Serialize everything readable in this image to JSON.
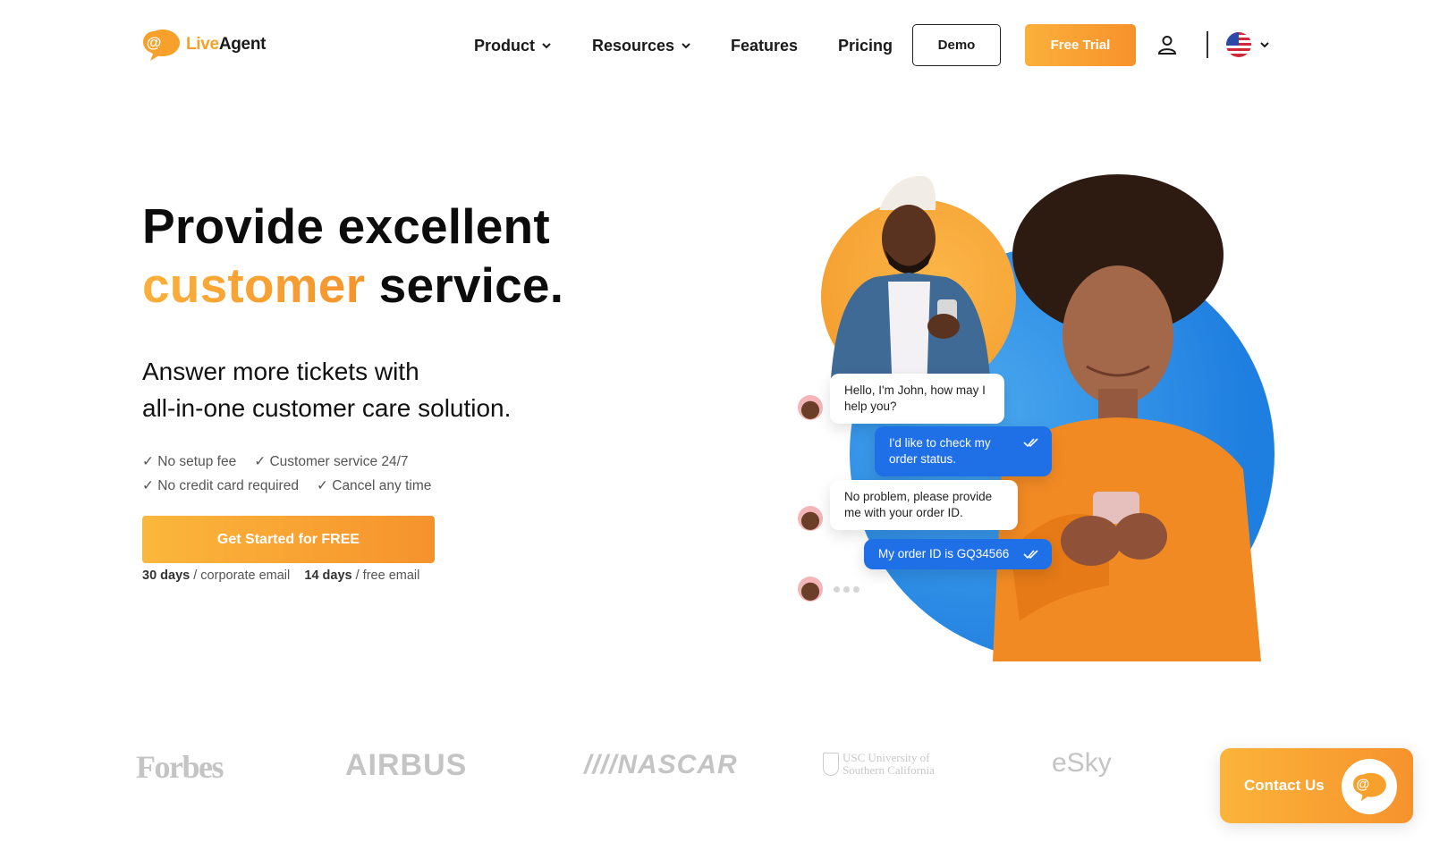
{
  "header": {
    "logo": {
      "live": "Live",
      "agent": "Agent"
    },
    "nav": [
      {
        "label": "Product",
        "has_dropdown": true
      },
      {
        "label": "Resources",
        "has_dropdown": true
      },
      {
        "label": "Features",
        "has_dropdown": false
      },
      {
        "label": "Pricing",
        "has_dropdown": false
      }
    ],
    "demo_label": "Demo",
    "free_trial_label": "Free Trial",
    "user_icon": "user-icon",
    "language_icon": "us-flag-icon"
  },
  "hero": {
    "title_line1": "Provide excellent",
    "title_accent": "customer",
    "title_rest": " service.",
    "subtitle_line1": "Answer more tickets with",
    "subtitle_line2": "all-in-one customer care solution.",
    "checks": [
      [
        "✓ No setup fee",
        "✓ Customer service 24/7"
      ],
      [
        "✓ No credit card required",
        "✓ Cancel any time"
      ]
    ],
    "cta_label": "Get Started for FREE",
    "trial_note": {
      "corporate_days": "30 days",
      "corporate_text": " / corporate email",
      "free_days": "14 days",
      "free_text": " / free email"
    }
  },
  "chat": {
    "messages": [
      {
        "from": "agent",
        "text": "Hello, I'm John, how may I help you?"
      },
      {
        "from": "customer",
        "text": "I'd like to check my order status.",
        "status": "read"
      },
      {
        "from": "agent",
        "text": "No problem, please provide me with your order ID."
      },
      {
        "from": "customer",
        "text": "My order ID is GQ34566",
        "status": "read"
      }
    ],
    "typing": true
  },
  "logos": {
    "forbes": "Forbes",
    "airbus": "AIRBUS",
    "nascar": "////NASCAR",
    "usc_line1": "USC University of",
    "usc_line2": "Southern California",
    "esky": "eSky"
  },
  "contact": {
    "label": "Contact Us"
  },
  "colors": {
    "brand_orange": "#f7a12c",
    "chat_blue": "#1f6fe6",
    "text_dark": "#111111"
  }
}
